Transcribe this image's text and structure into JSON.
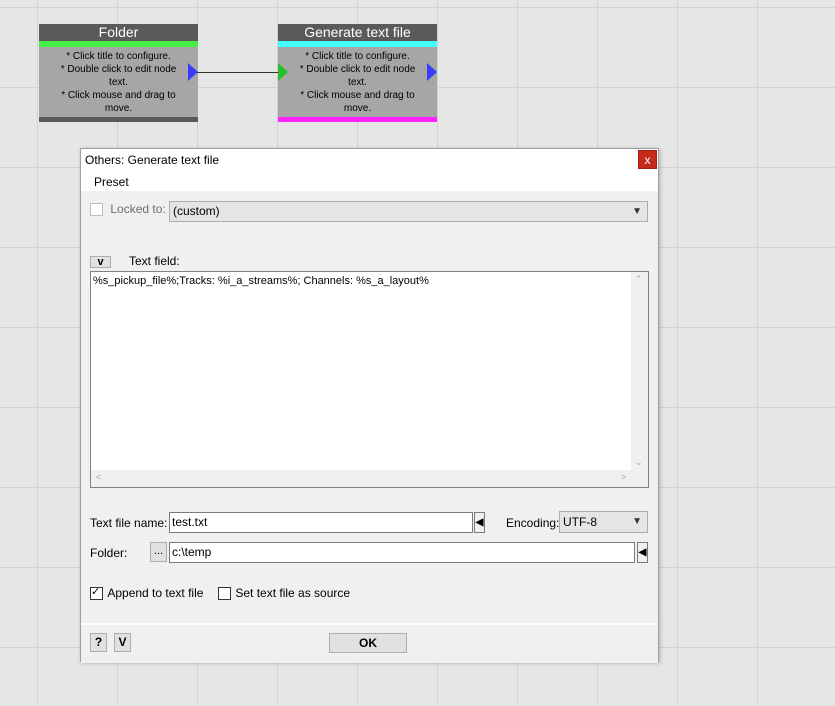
{
  "nodes": [
    {
      "title": "Folder",
      "text": "* Click title to configure.\n* Double click to edit node text.\n* Click mouse and drag to move.",
      "bar_color": "#44ee44",
      "bottom_color": "#5a5a5a"
    },
    {
      "title": "Generate text file",
      "text": "* Click title to configure.\n* Double click to edit node text.\n* Click mouse and drag to move.",
      "bar_color": "#44ffff",
      "bottom_color": "#ff22ff"
    }
  ],
  "dialog": {
    "title": "Others: Generate text file",
    "close_label": "x",
    "menu": {
      "preset": "Preset"
    },
    "locked_to_label": "Locked to:",
    "locked_to_value": "(custom)",
    "toggle_label": "v",
    "text_field_label": "Text field:",
    "text_field_value": "%s_pickup_file%;Tracks: %i_a_streams%; Channels: %s_a_layout%",
    "text_file_name_label": "Text file name:",
    "text_file_name_value": "test.txt",
    "encoding_label": "Encoding:",
    "encoding_value": "UTF-8",
    "folder_label": "Folder:",
    "folder_browse": "...",
    "folder_value": "c:\\temp",
    "append_label": "Append to text file",
    "append_checked": true,
    "set_source_label": "Set text file as source",
    "set_source_checked": false,
    "help_button": "?",
    "v_button": "V",
    "ok_button": "OK"
  }
}
